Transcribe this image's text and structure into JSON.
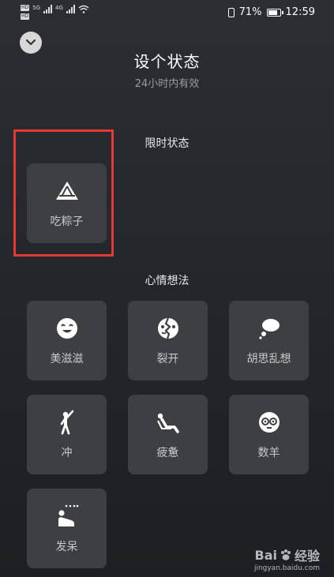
{
  "status_bar": {
    "hd1": "HD",
    "hd2": "HD",
    "net1": "5G",
    "net2": "4G",
    "battery_pct": "71%",
    "time": "12:59"
  },
  "header": {
    "title": "设个状态",
    "subtitle": "24小时内有效"
  },
  "limited_section": {
    "title": "限时状态",
    "items": [
      {
        "label": "吃粽子",
        "icon": "zongzi-icon"
      }
    ]
  },
  "mood_section": {
    "title": "心情想法",
    "items": [
      {
        "label": "美滋滋",
        "icon": "smile-icon"
      },
      {
        "label": "裂开",
        "icon": "cracked-face-icon"
      },
      {
        "label": "胡思乱想",
        "icon": "thought-bubble-icon"
      },
      {
        "label": "冲",
        "icon": "cheering-person-icon"
      },
      {
        "label": "疲惫",
        "icon": "tired-person-icon"
      },
      {
        "label": "数羊",
        "icon": "sheep-face-icon"
      },
      {
        "label": "发呆",
        "icon": "daze-person-icon"
      }
    ]
  },
  "watermark": {
    "brand": "Bai",
    "brand2": "经验",
    "url": "jingyan.baidu.com"
  },
  "colors": {
    "highlight": "#e53935",
    "tile": "#3d3f43"
  }
}
